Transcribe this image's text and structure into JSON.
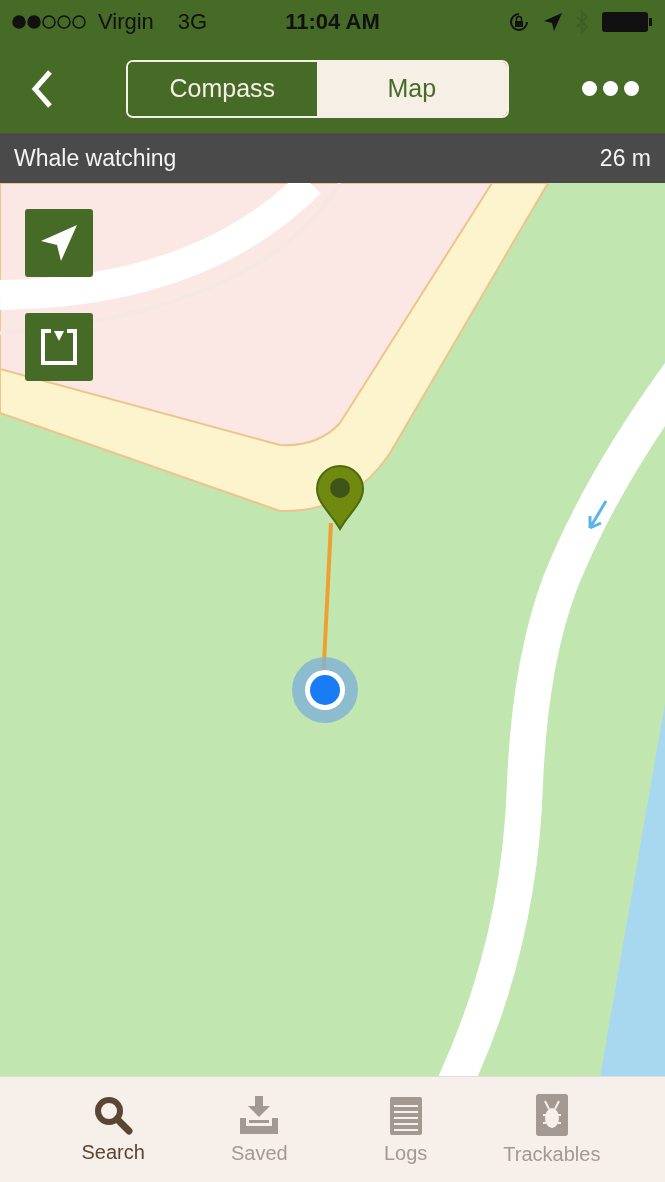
{
  "status_bar": {
    "carrier": "Virgin",
    "network": "3G",
    "time": "11:04 AM"
  },
  "nav_bar": {
    "segments": [
      {
        "label": "Compass",
        "selected": false
      },
      {
        "label": "Map",
        "selected": true
      }
    ]
  },
  "info_strip": {
    "title": "Whale watching",
    "distance": "26 m"
  },
  "tab_bar": [
    {
      "label": "Search",
      "selected": true
    },
    {
      "label": "Saved",
      "selected": false
    },
    {
      "label": "Logs",
      "selected": false
    },
    {
      "label": "Trackables",
      "selected": false
    }
  ]
}
